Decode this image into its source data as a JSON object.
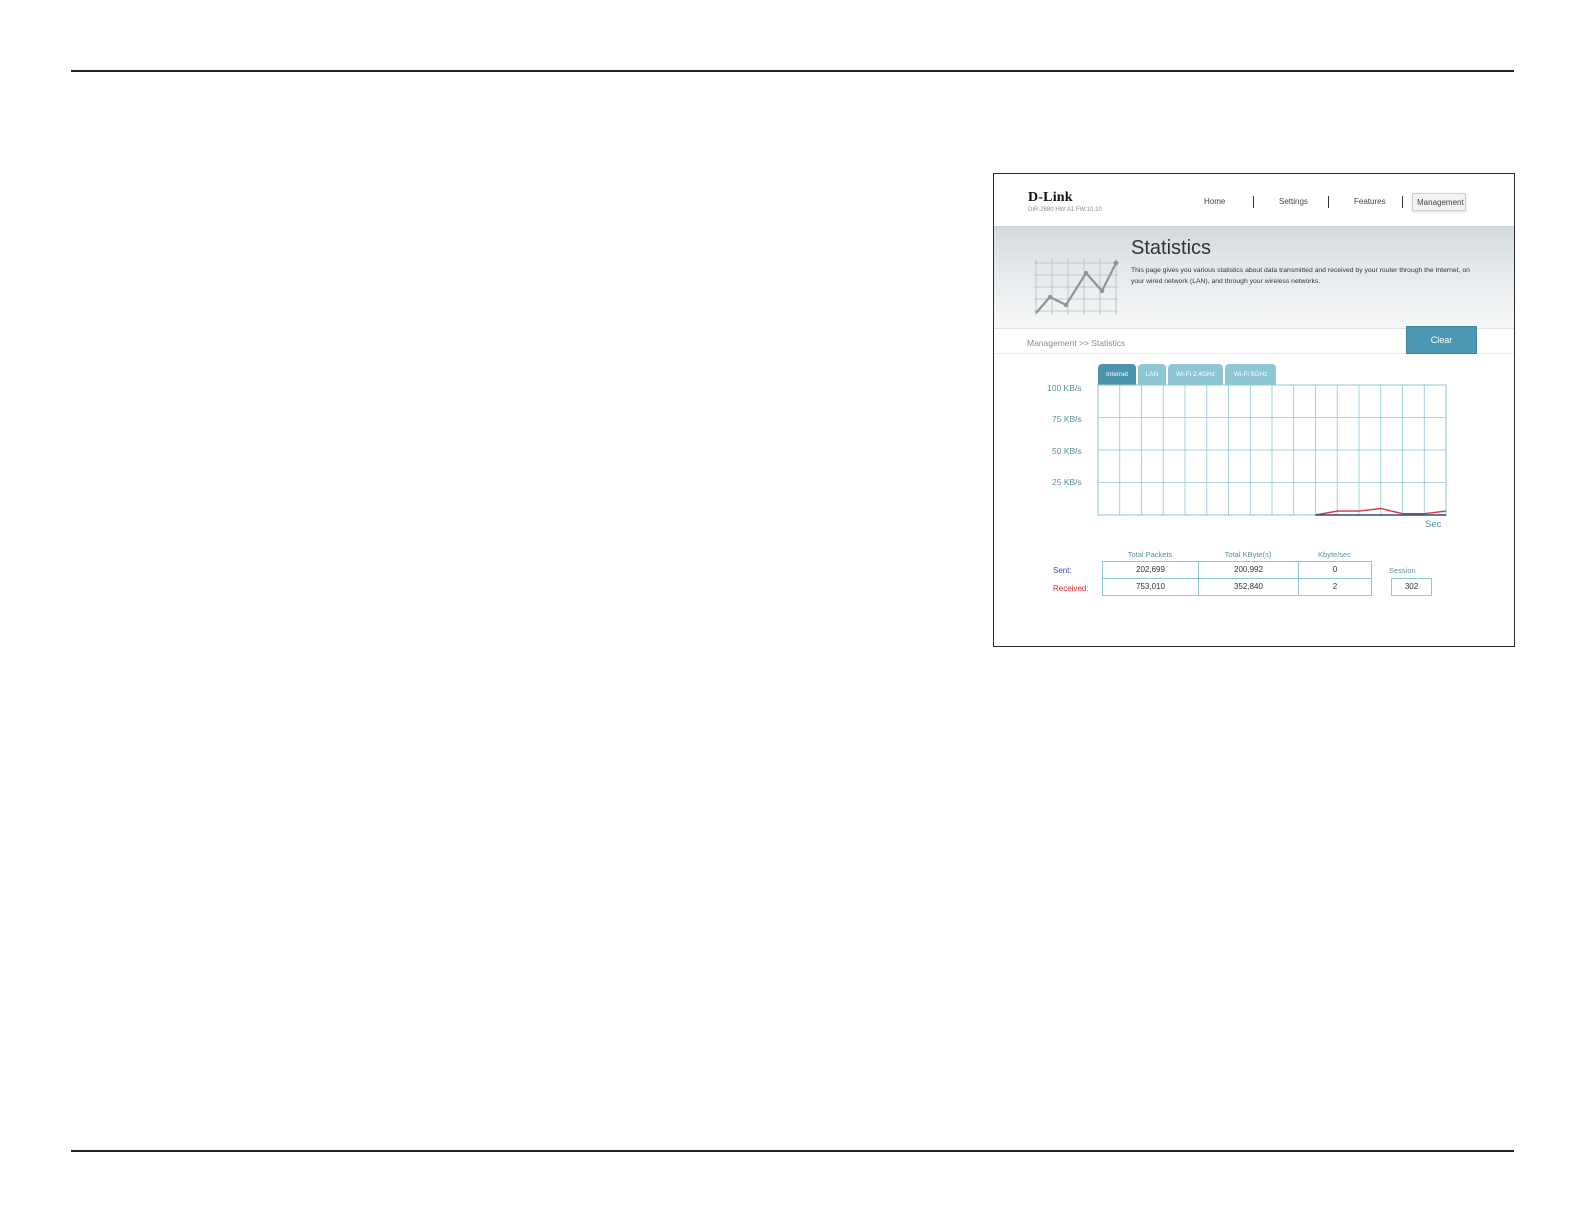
{
  "header": {
    "logo": "D-Link",
    "model": "DIR-2680 HW:A1 FW:10.10",
    "nav": [
      "Home",
      "Settings",
      "Features",
      "Management"
    ]
  },
  "banner": {
    "title": "Statistics",
    "description": "This page gives you various statistics about data transmitted and received by your router through the Internet, on your wired network (LAN), and through your wireless networks."
  },
  "breadcrumb": "Management >> Statistics",
  "clear_label": "Clear",
  "tabs": [
    "Internet",
    "LAN",
    "Wi-Fi 2.4GHz",
    "Wi-Fi 5GHz"
  ],
  "active_tab": "Internet",
  "chart_data": {
    "type": "line",
    "y_tick_labels": [
      "100 KB/s",
      "75 KB/s",
      "50 KB/s",
      "25 KB/s"
    ],
    "ylim": [
      0,
      100
    ],
    "xlabel": "Sec",
    "grid": true,
    "series": [
      {
        "color": "#d8343b",
        "x": [
          10,
          11,
          12,
          13,
          14,
          15,
          16
        ],
        "values": [
          0,
          3,
          3,
          5,
          1,
          1,
          3
        ]
      },
      {
        "color": "#2b4c8c",
        "x": [
          10,
          16
        ],
        "values": [
          0,
          0
        ]
      }
    ]
  },
  "stats": {
    "columns": [
      "Total Packets",
      "Total KByte(s)",
      "Kbyte/sec"
    ],
    "rows": [
      {
        "label": "Sent:",
        "color": "#3a4fa0",
        "values": [
          "202,699",
          "200,992",
          "0"
        ]
      },
      {
        "label": "Received:",
        "color": "#e02020",
        "values": [
          "753,010",
          "352,840",
          "2"
        ]
      }
    ],
    "session_label": "Session",
    "session_value": "302"
  },
  "colors": {
    "accent": "#4a98b1",
    "grid": "#8fc6d4",
    "received": "#d8343b",
    "sent": "#2b4c8c"
  }
}
